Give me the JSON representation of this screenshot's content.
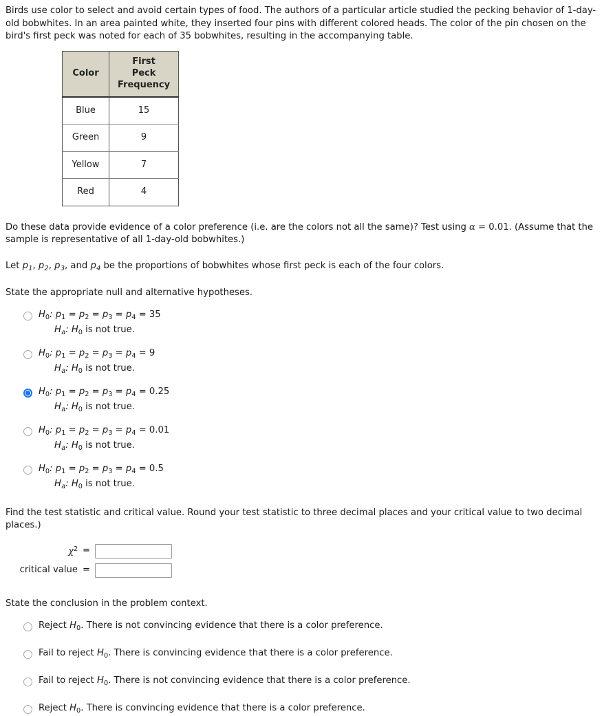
{
  "intro": {
    "paragraph": "Birds use color to select and avoid certain types of food. The authors of a particular article studied the pecking behavior of 1-day-old bobwhites. In an area painted white, they inserted four pins with different colored heads. The color of the pin chosen on the bird's first peck was noted for each of 35 bobwhites, resulting in the accompanying table."
  },
  "table": {
    "headers": {
      "color": "Color",
      "freq_line1": "First",
      "freq_line2": "Peck",
      "freq_line3": "Frequency"
    },
    "rows": [
      {
        "color": "Blue",
        "frequency": "15"
      },
      {
        "color": "Green",
        "frequency": "9"
      },
      {
        "color": "Yellow",
        "frequency": "7"
      },
      {
        "color": "Red",
        "frequency": "4"
      }
    ],
    "header_bg": "#d8d4c6"
  },
  "question": {
    "prompt_part1": "Do these data provide evidence of a color preference (i.e. are the colors not all the same)? Test using ",
    "alpha_symbol": "α",
    "alpha_value": " = 0.01. (Assume that the sample is representative of all 1-day-old bobwhites.)",
    "let_line": {
      "lead": "Let ",
      "p_symbol": "p",
      "subs": [
        "1",
        "2",
        "3",
        "4"
      ],
      "sep1": ", ",
      "sep2": ", ",
      "sep3": ", and ",
      "tail": " be the proportions of bobwhites whose first peck is each of the four colors."
    },
    "state_hypotheses": "State the appropriate null and alternative hypotheses."
  },
  "hypotheses": {
    "null_prefix": "H",
    "null_sub": "0",
    "null_colon": ": ",
    "p_symbol": "p",
    "alt_prefix": "H",
    "alt_sub": "a",
    "alt_text": ": H",
    "alt_sub2": "0",
    "alt_tail": " is not true.",
    "options": [
      {
        "value": "35",
        "selected": false
      },
      {
        "value": "9",
        "selected": false
      },
      {
        "value": "0.25",
        "selected": true
      },
      {
        "value": "0.01",
        "selected": false
      },
      {
        "value": "0.5",
        "selected": false
      }
    ]
  },
  "test_stat": {
    "instruction": "Find the test statistic and critical value. Round your test statistic to three decimal places and your critical value to two decimal places.)",
    "chi_symbol": "χ",
    "chi_exponent": "2",
    "equals": "=",
    "chi_value": "",
    "chi_placeholder": "",
    "critical_label": "critical value",
    "critical_value": "",
    "critical_placeholder": ""
  },
  "conclusion": {
    "prompt": "State the conclusion in the problem context.",
    "options": [
      {
        "action": "Reject ",
        "h": "H",
        "hsub": "0",
        "text": ". There is not convincing evidence that there is a color preference.",
        "selected": false
      },
      {
        "action": "Fail to reject ",
        "h": "H",
        "hsub": "0",
        "text": ". There is convincing evidence that there is a color preference.",
        "selected": false
      },
      {
        "action": "Fail to reject ",
        "h": "H",
        "hsub": "0",
        "text": ". There is not convincing evidence that there is a color preference.",
        "selected": false
      },
      {
        "action": "Reject ",
        "h": "H",
        "hsub": "0",
        "text": ". There is convincing evidence that there is a color preference.",
        "selected": false
      }
    ]
  },
  "colors": {
    "accent": "#1a73e8",
    "radio_border": "#a8a8a8",
    "table_border": "#555555",
    "text": "#1a1a1a"
  }
}
